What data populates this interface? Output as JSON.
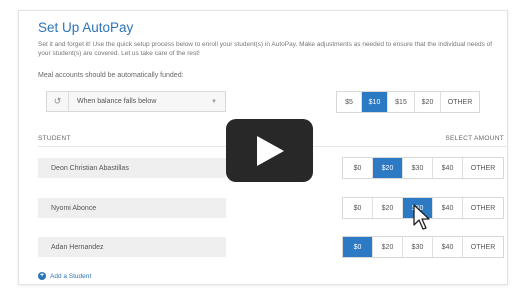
{
  "title": "Set Up AutoPay",
  "description": "Set it and forget it! Use the quick setup process below to enroll your student(s) in AutoPay. Make adjustments as needed to ensure that the individual needs of your student(s) are covered. Let us take care of the rest!",
  "meal_label": "Meal accounts should be automatically funded:",
  "dropdown": {
    "value": "When balance falls below",
    "icon": "clock-history-icon"
  },
  "threshold": {
    "options": [
      "$5",
      "$10",
      "$15",
      "$20",
      "OTHER"
    ],
    "selected": "$10"
  },
  "columns": {
    "student": "STUDENT",
    "amount": "SELECT AMOUNT"
  },
  "students": [
    {
      "name": "Deon Christian Abastillas",
      "options": [
        "$0",
        "$20",
        "$30",
        "$40",
        "OTHER"
      ],
      "selected": "$20"
    },
    {
      "name": "Nyomi Abonce",
      "options": [
        "$0",
        "$20",
        "$30",
        "$40",
        "OTHER"
      ],
      "selected": "$30"
    },
    {
      "name": "Adan Hernandez",
      "options": [
        "$0",
        "$20",
        "$30",
        "$40",
        "OTHER"
      ],
      "selected": "$0"
    }
  ],
  "add_student": "Add a Student",
  "colors": {
    "accent": "#2c79c4",
    "title": "#2c74b8",
    "overlay": "#161616"
  }
}
